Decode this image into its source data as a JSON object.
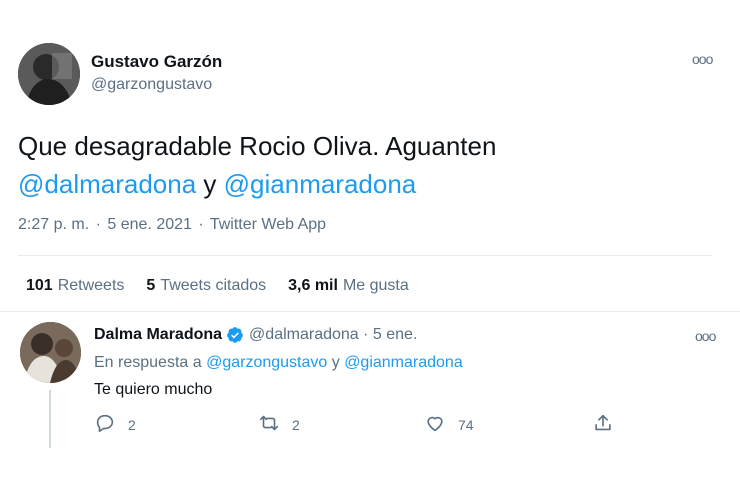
{
  "tweet": {
    "author_name": "Gustavo Garzón",
    "author_handle": "@garzongustavo",
    "text_line1": "Que desagradable Rocio Oliva. Aguanten",
    "mention1": "@dalmaradona",
    "conjunction": "y",
    "mention2": "@gianmaradona",
    "time": "2:27 p. m.",
    "date": "5 ene. 2021",
    "source": "Twitter Web App",
    "more_label": "ooo"
  },
  "stats": {
    "retweets_count": "101",
    "retweets_label": "Retweets",
    "quotes_count": "5",
    "quotes_label": "Tweets citados",
    "likes_count": "3,6 mil",
    "likes_label": "Me gusta"
  },
  "reply": {
    "author_name": "Dalma Maradona",
    "author_handle": "@dalmaradona",
    "date": "5 ene.",
    "reply_prefix": "En respuesta a",
    "reply_mention1": "@garzongustavo",
    "reply_conjunction": "y",
    "reply_mention2": "@gianmaradona",
    "text": "Te quiero mucho",
    "replies": "2",
    "retweets": "2",
    "likes": "74",
    "more_label": "ooo"
  },
  "colors": {
    "accent": "#1d9bf0",
    "muted": "#5b7083",
    "text": "#0f1419",
    "border": "#e6ecf0"
  },
  "icons": [
    "reply-icon",
    "retweet-icon",
    "like-icon",
    "share-icon",
    "verified-icon",
    "more-icon"
  ]
}
